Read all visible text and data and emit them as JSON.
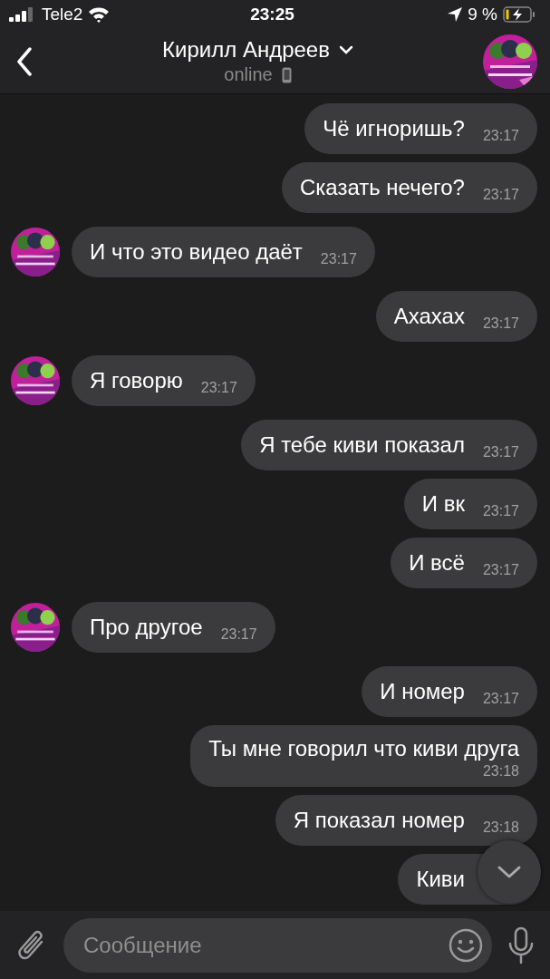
{
  "status_bar": {
    "carrier": "Tele2",
    "time": "23:25",
    "battery": "9 %"
  },
  "header": {
    "name": "Кирилл Андреев",
    "status": "online"
  },
  "messages": [
    {
      "kind": "outgoing",
      "text": "Чё игноришь?",
      "time": "23:17"
    },
    {
      "kind": "outgoing",
      "text": "Сказать нечего?",
      "time": "23:17"
    },
    {
      "kind": "incoming",
      "text": "И что это видео даёт",
      "time": "23:17"
    },
    {
      "kind": "outgoing",
      "text": "Ахахах",
      "time": "23:17"
    },
    {
      "kind": "incoming",
      "text": "Я говорю",
      "time": "23:17"
    },
    {
      "kind": "outgoing",
      "text": "Я тебе киви показал",
      "time": "23:17"
    },
    {
      "kind": "outgoing",
      "text": "И вк",
      "time": "23:17"
    },
    {
      "kind": "outgoing",
      "text": "И всё",
      "time": "23:17"
    },
    {
      "kind": "incoming",
      "text": "Про другое",
      "time": "23:17"
    },
    {
      "kind": "outgoing",
      "text": "И номер",
      "time": "23:17"
    },
    {
      "kind": "outgoing-long",
      "text": "Ты мне говорил что киви друга",
      "time": "23:18"
    },
    {
      "kind": "outgoing",
      "text": "Я показал номер",
      "time": "23:18"
    },
    {
      "kind": "outgoing",
      "text": "Киви"
    }
  ],
  "composer": {
    "placeholder": "Сообщение"
  }
}
